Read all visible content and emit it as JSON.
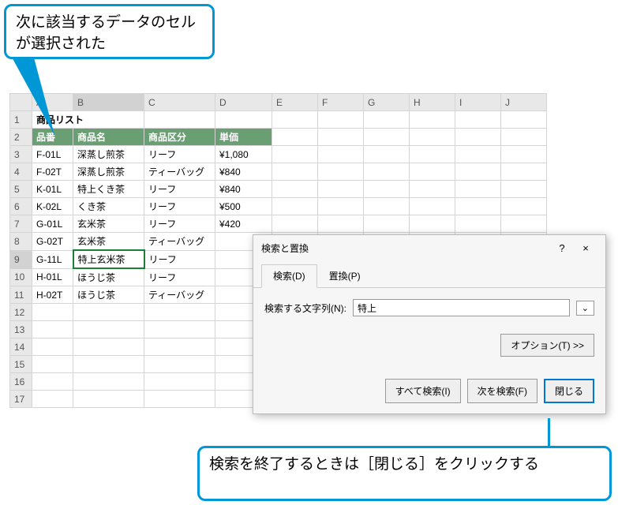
{
  "callouts": {
    "top": "次に該当するデータのセルが選択された",
    "bottom": "検索を終了するときは［閉じる］をクリックする"
  },
  "sheet": {
    "columns": [
      "A",
      "B",
      "C",
      "D",
      "E",
      "F",
      "G",
      "H",
      "I",
      "J"
    ],
    "title": "商品リスト",
    "headers": {
      "code": "品番",
      "name": "商品名",
      "category": "商品区分",
      "price": "単価"
    },
    "rows": [
      {
        "code": "F-01L",
        "name": "深蒸し煎茶",
        "category": "リーフ",
        "price": "¥1,080"
      },
      {
        "code": "F-02T",
        "name": "深蒸し煎茶",
        "category": "ティーバッグ",
        "price": "¥840"
      },
      {
        "code": "K-01L",
        "name": "特上くき茶",
        "category": "リーフ",
        "price": "¥840"
      },
      {
        "code": "K-02L",
        "name": "くき茶",
        "category": "リーフ",
        "price": "¥500"
      },
      {
        "code": "G-01L",
        "name": "玄米茶",
        "category": "リーフ",
        "price": "¥420"
      },
      {
        "code": "G-02T",
        "name": "玄米茶",
        "category": "ティーバッグ",
        "price": ""
      },
      {
        "code": "G-11L",
        "name": "特上玄米茶",
        "category": "リーフ",
        "price": ""
      },
      {
        "code": "H-01L",
        "name": "ほうじ茶",
        "category": "リーフ",
        "price": ""
      },
      {
        "code": "H-02T",
        "name": "ほうじ茶",
        "category": "ティーバッグ",
        "price": ""
      }
    ],
    "selected_cell": "B9",
    "empty_rows": [
      12,
      13,
      14,
      15,
      16,
      17
    ]
  },
  "dialog": {
    "title": "検索と置換",
    "help": "?",
    "close_x": "×",
    "tabs": {
      "find": "検索(D)",
      "replace": "置換(P)"
    },
    "find_label": "検索する文字列(N):",
    "find_value": "特上",
    "options_btn": "オプション(T) >>",
    "find_all_btn": "すべて検索(I)",
    "find_next_btn": "次を検索(F)",
    "close_btn": "閉じる"
  }
}
